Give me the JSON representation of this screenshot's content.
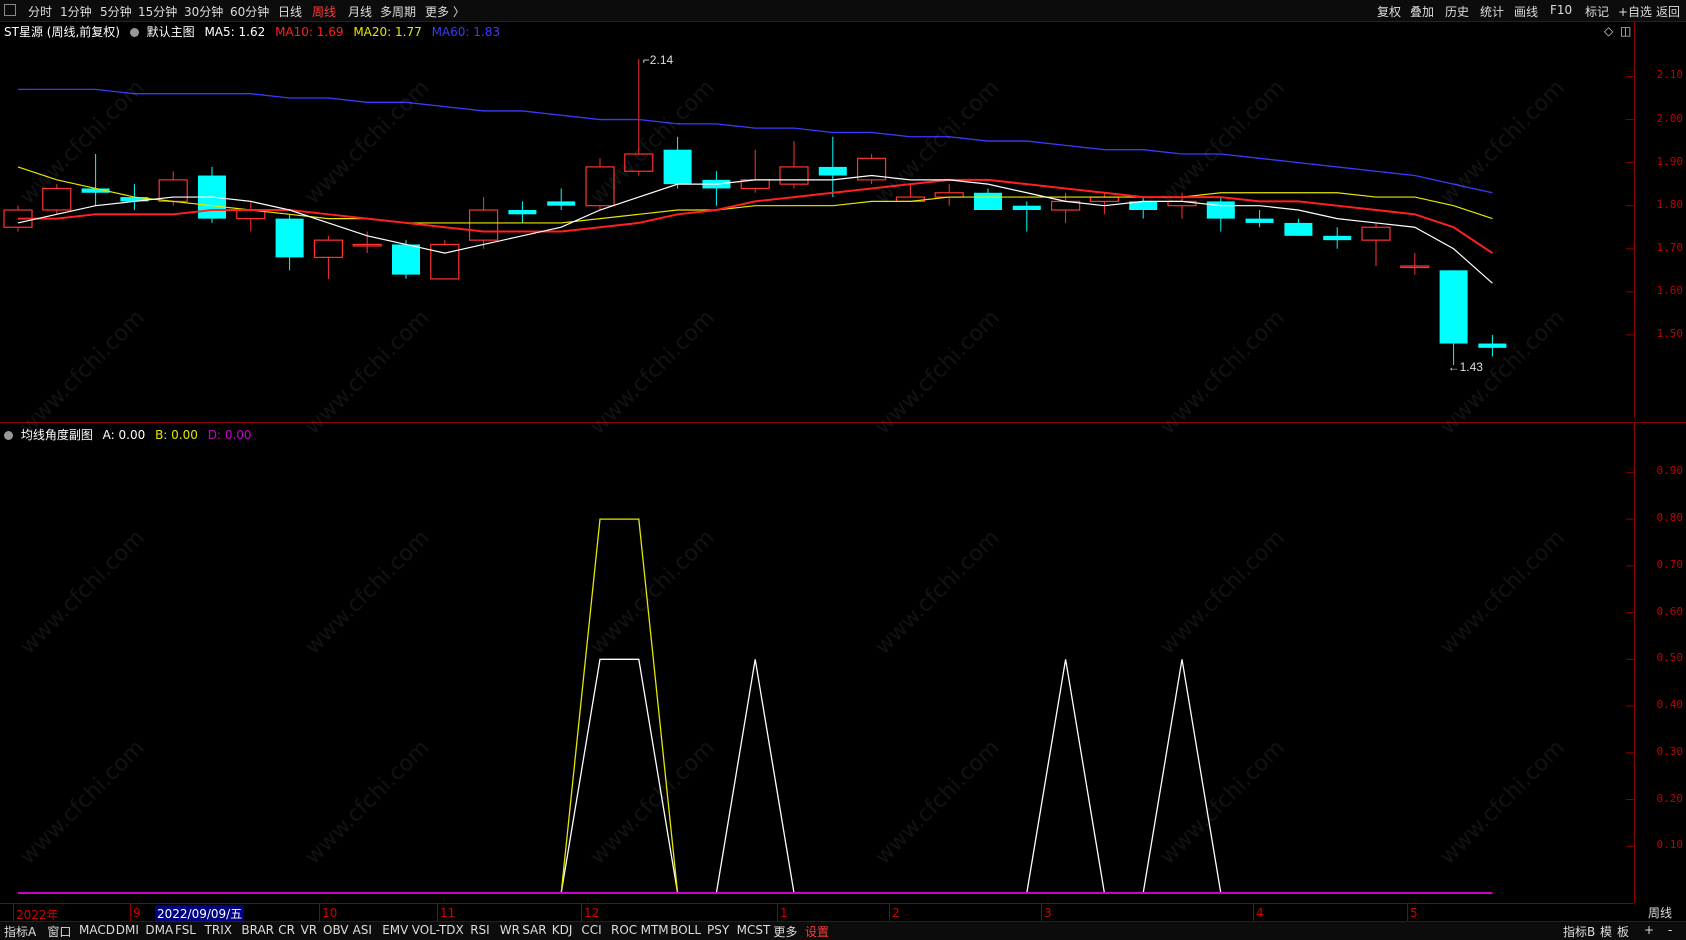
{
  "topbar": {
    "periods": [
      "分时",
      "1分钟",
      "5分钟",
      "15分钟",
      "30分钟",
      "60分钟",
      "日线",
      "周线",
      "月线",
      "多周期",
      "更多 〉"
    ],
    "active_period": "周线",
    "right_tools": [
      "复权",
      "叠加",
      "历史",
      "统计",
      "画线",
      "F10",
      "标记",
      "+自选",
      "返回"
    ]
  },
  "main_panel": {
    "stock": "ST星源 (周线,前复权)",
    "template": "默认主图",
    "ma5": "MA5: 1.62",
    "ma10": "MA10: 1.69",
    "ma20": "MA20: 1.77",
    "ma60": "MA60: 1.83",
    "high_label": "2.14",
    "low_label": "1.43",
    "axis_ticks": [
      "2.10",
      "2.00",
      "1.90",
      "1.80",
      "1.70",
      "1.60",
      "1.50"
    ]
  },
  "sub_panel": {
    "name": "均线角度副图",
    "a": "A: 0.00",
    "b": "B: 0.00",
    "d": "D: 0.00",
    "axis_ticks": [
      "0.90",
      "0.80",
      "0.70",
      "0.60",
      "0.50",
      "0.40",
      "0.30",
      "0.20",
      "0.10"
    ],
    "period_label": "周线"
  },
  "date_axis": {
    "ticks": [
      "2022年",
      "9",
      "10",
      "11",
      "12",
      "1",
      "2",
      "3",
      "4",
      "5"
    ],
    "selected": "2022/09/09/五"
  },
  "bottombar": {
    "indicators": [
      "指标A",
      "窗口",
      "MACD",
      "DMI",
      "DMA",
      "FSL",
      "TRIX",
      "BRAR",
      "CR",
      "VR",
      "OBV",
      "ASI",
      "EMV",
      "VOL-TDX",
      "RSI",
      "WR",
      "SAR",
      "KDJ",
      "CCI",
      "ROC",
      "MTM",
      "BOLL",
      "PSY",
      "MCST",
      "更多",
      "设置"
    ],
    "right_items": [
      "指标B",
      "模",
      "板",
      "+",
      "-"
    ]
  },
  "watermark": "www.cfchi.com",
  "colors": {
    "up": "#ff3232",
    "down": "#00ffff",
    "ma5": "#ffffff",
    "ma10": "#ff2020",
    "ma20": "#e6e600",
    "ma60": "#3a3aff",
    "axis": "#c00000"
  },
  "chart_data": {
    "type": "candlestick",
    "candles": [
      {
        "o": 1.75,
        "c": 1.79,
        "h": 1.8,
        "l": 1.74
      },
      {
        "o": 1.79,
        "c": 1.84,
        "h": 1.85,
        "l": 1.78
      },
      {
        "o": 1.84,
        "c": 1.83,
        "h": 1.92,
        "l": 1.8
      },
      {
        "o": 1.82,
        "c": 1.81,
        "h": 1.85,
        "l": 1.79
      },
      {
        "o": 1.81,
        "c": 1.86,
        "h": 1.88,
        "l": 1.8
      },
      {
        "o": 1.87,
        "c": 1.77,
        "h": 1.89,
        "l": 1.76
      },
      {
        "o": 1.77,
        "c": 1.79,
        "h": 1.81,
        "l": 1.74
      },
      {
        "o": 1.77,
        "c": 1.68,
        "h": 1.78,
        "l": 1.65
      },
      {
        "o": 1.68,
        "c": 1.72,
        "h": 1.73,
        "l": 1.63
      },
      {
        "o": 1.71,
        "c": 1.71,
        "h": 1.74,
        "l": 1.69
      },
      {
        "o": 1.71,
        "c": 1.64,
        "h": 1.72,
        "l": 1.63
      },
      {
        "o": 1.63,
        "c": 1.71,
        "h": 1.72,
        "l": 1.63
      },
      {
        "o": 1.72,
        "c": 1.79,
        "h": 1.82,
        "l": 1.7
      },
      {
        "o": 1.79,
        "c": 1.78,
        "h": 1.81,
        "l": 1.76
      },
      {
        "o": 1.81,
        "c": 1.8,
        "h": 1.84,
        "l": 1.79
      },
      {
        "o": 1.8,
        "c": 1.89,
        "h": 1.91,
        "l": 1.79
      },
      {
        "o": 1.88,
        "c": 1.92,
        "h": 2.14,
        "l": 1.87
      },
      {
        "o": 1.93,
        "c": 1.85,
        "h": 1.96,
        "l": 1.84
      },
      {
        "o": 1.86,
        "c": 1.84,
        "h": 1.88,
        "l": 1.8
      },
      {
        "o": 1.84,
        "c": 1.86,
        "h": 1.93,
        "l": 1.83
      },
      {
        "o": 1.85,
        "c": 1.89,
        "h": 1.95,
        "l": 1.84
      },
      {
        "o": 1.89,
        "c": 1.87,
        "h": 1.96,
        "l": 1.82
      },
      {
        "o": 1.86,
        "c": 1.91,
        "h": 1.92,
        "l": 1.85
      },
      {
        "o": 1.81,
        "c": 1.82,
        "h": 1.85,
        "l": 1.81
      },
      {
        "o": 1.82,
        "c": 1.83,
        "h": 1.85,
        "l": 1.8
      },
      {
        "o": 1.83,
        "c": 1.79,
        "h": 1.84,
        "l": 1.79
      },
      {
        "o": 1.8,
        "c": 1.79,
        "h": 1.81,
        "l": 1.74
      },
      {
        "o": 1.79,
        "c": 1.81,
        "h": 1.83,
        "l": 1.76
      },
      {
        "o": 1.81,
        "c": 1.82,
        "h": 1.83,
        "l": 1.78
      },
      {
        "o": 1.81,
        "c": 1.79,
        "h": 1.82,
        "l": 1.77
      },
      {
        "o": 1.8,
        "c": 1.81,
        "h": 1.83,
        "l": 1.77
      },
      {
        "o": 1.81,
        "c": 1.77,
        "h": 1.82,
        "l": 1.74
      },
      {
        "o": 1.77,
        "c": 1.76,
        "h": 1.79,
        "l": 1.75
      },
      {
        "o": 1.76,
        "c": 1.73,
        "h": 1.77,
        "l": 1.73
      },
      {
        "o": 1.73,
        "c": 1.72,
        "h": 1.75,
        "l": 1.7
      },
      {
        "o": 1.72,
        "c": 1.75,
        "h": 1.76,
        "l": 1.66
      },
      {
        "o": 1.66,
        "c": 1.66,
        "h": 1.69,
        "l": 1.64
      },
      {
        "o": 1.65,
        "c": 1.48,
        "h": 1.65,
        "l": 1.43
      },
      {
        "o": 1.48,
        "c": 1.47,
        "h": 1.5,
        "l": 1.45
      }
    ],
    "ma5": [
      1.76,
      1.78,
      1.8,
      1.81,
      1.82,
      1.82,
      1.81,
      1.79,
      1.76,
      1.73,
      1.71,
      1.69,
      1.71,
      1.73,
      1.75,
      1.79,
      1.82,
      1.85,
      1.85,
      1.86,
      1.86,
      1.86,
      1.87,
      1.86,
      1.86,
      1.85,
      1.83,
      1.81,
      1.8,
      1.81,
      1.81,
      1.8,
      1.8,
      1.79,
      1.77,
      1.76,
      1.75,
      1.7,
      1.62
    ],
    "ma10": [
      1.77,
      1.77,
      1.78,
      1.78,
      1.78,
      1.79,
      1.79,
      1.79,
      1.78,
      1.77,
      1.76,
      1.75,
      1.74,
      1.74,
      1.74,
      1.75,
      1.76,
      1.78,
      1.79,
      1.81,
      1.82,
      1.83,
      1.84,
      1.85,
      1.86,
      1.86,
      1.85,
      1.84,
      1.83,
      1.82,
      1.82,
      1.82,
      1.81,
      1.81,
      1.8,
      1.79,
      1.78,
      1.75,
      1.69
    ],
    "ma20": [
      1.89,
      1.86,
      1.84,
      1.82,
      1.81,
      1.8,
      1.79,
      1.78,
      1.77,
      1.77,
      1.76,
      1.76,
      1.76,
      1.76,
      1.76,
      1.77,
      1.78,
      1.79,
      1.79,
      1.8,
      1.8,
      1.8,
      1.81,
      1.81,
      1.82,
      1.82,
      1.82,
      1.82,
      1.82,
      1.82,
      1.82,
      1.83,
      1.83,
      1.83,
      1.83,
      1.82,
      1.82,
      1.8,
      1.77
    ],
    "ma60": [
      2.07,
      2.07,
      2.07,
      2.06,
      2.06,
      2.06,
      2.06,
      2.05,
      2.05,
      2.04,
      2.04,
      2.03,
      2.02,
      2.02,
      2.01,
      2.0,
      2.0,
      1.99,
      1.99,
      1.98,
      1.98,
      1.97,
      1.97,
      1.96,
      1.96,
      1.95,
      1.95,
      1.94,
      1.93,
      1.93,
      1.92,
      1.92,
      1.91,
      1.9,
      1.89,
      1.88,
      1.87,
      1.85,
      1.83
    ],
    "sub_series": [
      {
        "name": "A",
        "color": "#ffffff",
        "values": [
          0,
          0,
          0,
          0,
          0,
          0,
          0,
          0,
          0,
          0,
          0,
          0,
          0,
          0,
          0,
          0.5,
          0.5,
          0,
          0,
          0.5,
          0,
          0,
          0,
          0,
          0,
          0,
          0,
          0.5,
          0,
          0,
          0.5,
          0,
          0,
          0,
          0,
          0,
          0,
          0,
          0
        ]
      },
      {
        "name": "B",
        "color": "#e6e600",
        "values": [
          0,
          0,
          0,
          0,
          0,
          0,
          0,
          0,
          0,
          0,
          0,
          0,
          0,
          0,
          0,
          0.8,
          0.8,
          0,
          0,
          0,
          0,
          0,
          0,
          0,
          0,
          0,
          0,
          0,
          0,
          0,
          0,
          0,
          0,
          0,
          0,
          0,
          0,
          0,
          0
        ]
      },
      {
        "name": "D",
        "color": "#cc00cc",
        "values": [
          0,
          0,
          0,
          0,
          0,
          0,
          0,
          0,
          0,
          0,
          0,
          0,
          0,
          0,
          0,
          0,
          0,
          0,
          0,
          0,
          0,
          0,
          0,
          0,
          0,
          0,
          0,
          0,
          0,
          0,
          0,
          0,
          0,
          0,
          0,
          0,
          0,
          0,
          0
        ]
      }
    ],
    "main_ylim": [
      1.4,
      2.18
    ],
    "sub_ylim": [
      0,
      0.95
    ]
  }
}
